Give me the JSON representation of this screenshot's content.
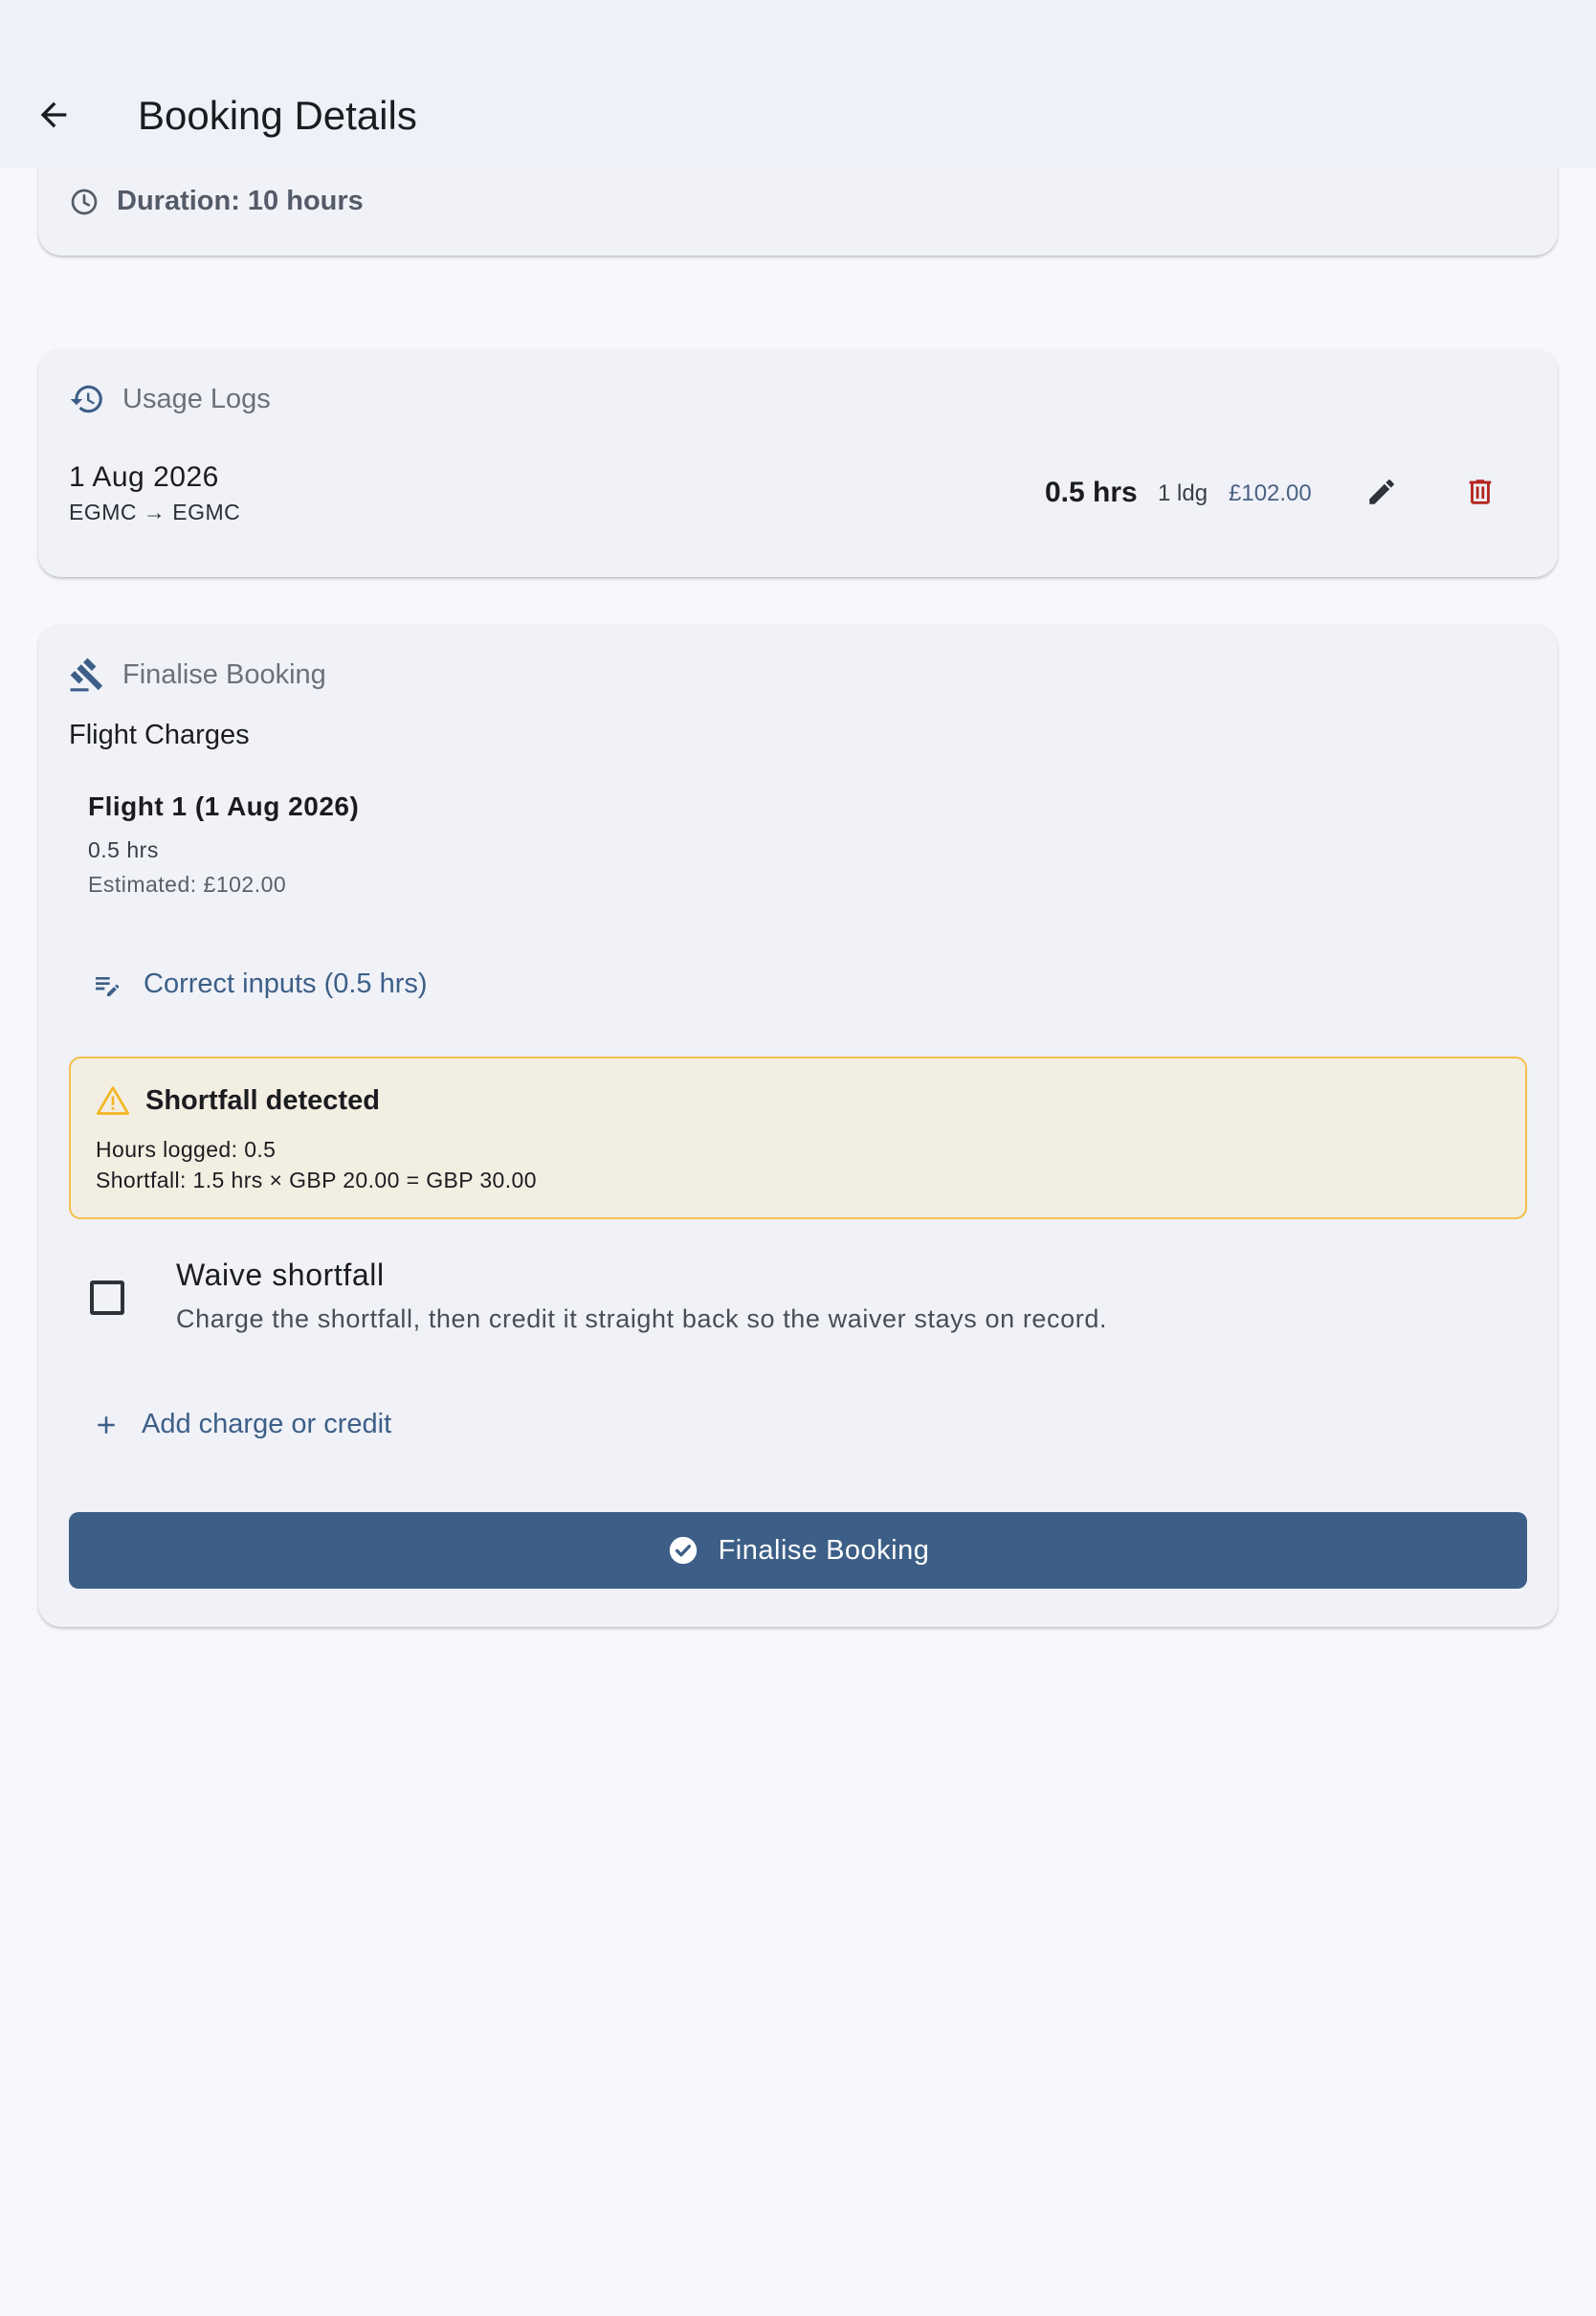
{
  "appbar": {
    "title": "Booking Details",
    "back_icon": "arrow-back-icon"
  },
  "summary": {
    "duration": "Duration: 10 hours",
    "icon": "clock-icon"
  },
  "usage_logs": {
    "title": "Usage Logs",
    "icon": "history-icon",
    "entries": [
      {
        "date": "1 Aug 2026",
        "route": "EGMC → EGMC",
        "hours": "0.5 hrs",
        "landings": "1 ldg",
        "cost": "£102.00",
        "edit_icon": "pencil-icon",
        "delete_icon": "trash-icon"
      }
    ]
  },
  "finalise": {
    "title": "Finalise Booking",
    "icon": "gavel-icon",
    "charges_label": "Flight Charges",
    "flights": [
      {
        "name": "Flight 1 (1 Aug 2026)",
        "hours": "0.5 hrs",
        "estimate": "Estimated: £102.00"
      }
    ],
    "correct_inputs_label": "Correct inputs (0.5 hrs)",
    "correct_inputs_icon": "edit-note-icon",
    "alert": {
      "title": "Shortfall detected",
      "icon": "warning-icon",
      "line1": "Hours logged: 0.5",
      "line2": "Shortfall: 1.5 hrs × GBP 20.00 = GBP 30.00"
    },
    "waive": {
      "title": "Waive shortfall",
      "description": "Charge the shortfall, then credit it straight back so the waiver stays on record.",
      "checked": false
    },
    "add_charge_label": "Add charge or credit",
    "add_icon": "plus-icon",
    "submit_label": "Finalise Booking",
    "submit_icon": "check-circle-icon"
  },
  "colors": {
    "primary": "#3d5f87",
    "danger": "#b3261e",
    "warning_border": "#f2c04d",
    "warning_bg": "#f3eee2",
    "appbar_bg": "#eef1f8"
  }
}
